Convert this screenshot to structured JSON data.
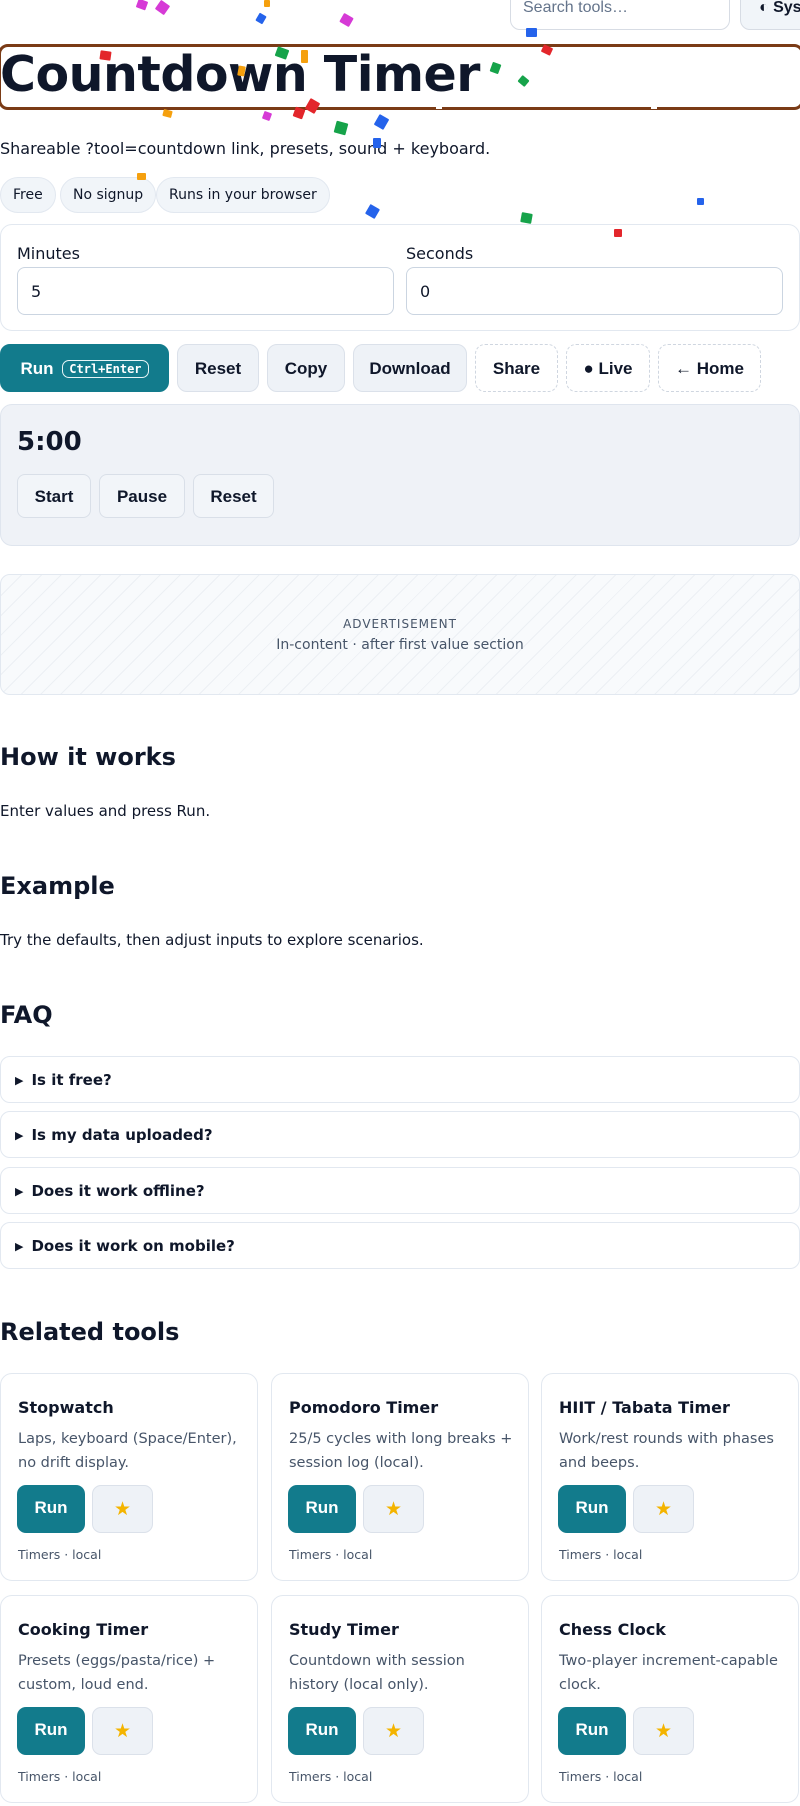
{
  "header": {
    "search_placeholder": "Search tools…",
    "theme_button": "◐ System",
    "theme_icon": "half-circle"
  },
  "page": {
    "title": "Countdown Timer",
    "subtitle": "Shareable ?tool=countdown link, presets, sound + keyboard.",
    "badges": [
      "Free",
      "No signup",
      "Runs in your browser"
    ]
  },
  "inputs": {
    "minutes_label": "Minutes",
    "minutes_value": "5",
    "seconds_label": "Seconds",
    "seconds_value": "0"
  },
  "toolbar": {
    "run_label": "Run",
    "run_shortcut": "Ctrl+Enter",
    "reset_label": "Reset",
    "copy_label": "Copy",
    "download_label": "Download",
    "share_label": "Share",
    "live_label": "● Live",
    "home_label": "← Home"
  },
  "timer": {
    "display": "5:00",
    "start_label": "Start",
    "pause_label": "Pause",
    "reset_label": "Reset"
  },
  "ad": {
    "label": "ADVERTISEMENT",
    "sub": "In-content · after first value section"
  },
  "how_it_works": {
    "heading": "How it works",
    "text": "Enter values and press Run."
  },
  "example": {
    "heading": "Example",
    "text": "Try the defaults, then adjust inputs to explore scenarios."
  },
  "faq": {
    "heading": "FAQ",
    "items": [
      "Is it free?",
      "Is my data uploaded?",
      "Does it work offline?",
      "Does it work on mobile?"
    ]
  },
  "related": {
    "heading": "Related tools",
    "run_label": "Run",
    "star_icon": "star",
    "cards": [
      {
        "title": "Stopwatch",
        "desc": "Laps, keyboard (Space/Enter), no drift display.",
        "meta": "Timers · local"
      },
      {
        "title": "Pomodoro Timer",
        "desc": "25/5 cycles with long breaks + session log (local).",
        "meta": "Timers · local"
      },
      {
        "title": "HIIT / Tabata Timer",
        "desc": "Work/rest rounds with phases and beeps.",
        "meta": "Timers · local"
      },
      {
        "title": "Cooking Timer",
        "desc": "Presets (eggs/pasta/rice) + custom, loud end.",
        "meta": "Timers · local"
      },
      {
        "title": "Study Timer",
        "desc": "Countdown with session history (local only).",
        "meta": "Timers · local"
      },
      {
        "title": "Chess Clock",
        "desc": "Two-player increment-capable clock.",
        "meta": "Timers · local"
      }
    ]
  },
  "colors": {
    "primary": "#127b8c",
    "text": "#0f172a",
    "muted": "#475569",
    "title_frame": "#7a3b16",
    "star": "#f4b400",
    "confetti": [
      "#d63ad6",
      "#e3262b",
      "#f5a00e",
      "#16a34a",
      "#2563eb",
      "#9333ea"
    ]
  }
}
